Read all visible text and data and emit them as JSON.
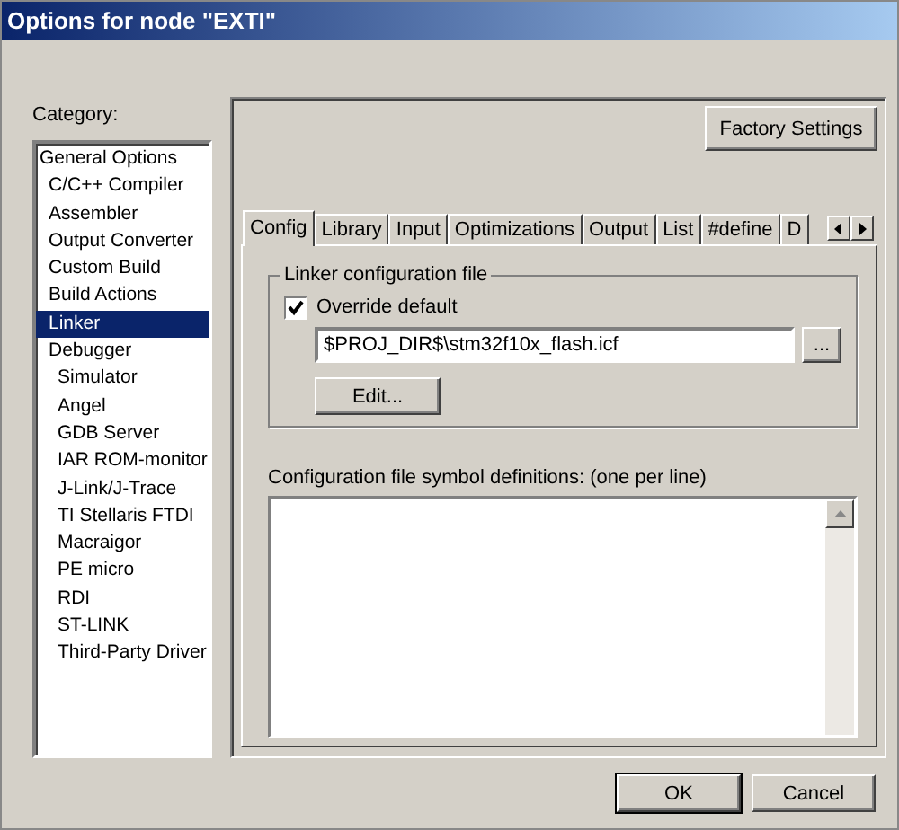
{
  "window": {
    "title": "Options for node \"EXTI\""
  },
  "category": {
    "label": "Category:",
    "items": [
      {
        "label": "General Options",
        "selected": false,
        "children": [
          {
            "label": "C/C++ Compiler",
            "selected": false
          },
          {
            "label": "Assembler",
            "selected": false
          },
          {
            "label": "Output Converter",
            "selected": false
          },
          {
            "label": "Custom Build",
            "selected": false
          },
          {
            "label": "Build Actions",
            "selected": false
          },
          {
            "label": "Linker",
            "selected": true
          },
          {
            "label": "Debugger",
            "selected": false,
            "children": [
              {
                "label": "Simulator",
                "selected": false
              },
              {
                "label": "Angel",
                "selected": false
              },
              {
                "label": "GDB Server",
                "selected": false
              },
              {
                "label": "IAR ROM-monitor",
                "selected": false
              },
              {
                "label": "J-Link/J-Trace",
                "selected": false
              },
              {
                "label": "TI Stellaris FTDI",
                "selected": false
              },
              {
                "label": "Macraigor",
                "selected": false
              },
              {
                "label": "PE micro",
                "selected": false
              },
              {
                "label": "RDI",
                "selected": false
              },
              {
                "label": "ST-LINK",
                "selected": false
              },
              {
                "label": "Third-Party Driver",
                "selected": false
              }
            ]
          }
        ]
      }
    ]
  },
  "factory_button": "Factory Settings",
  "tabs": [
    {
      "label": "Config",
      "selected": true
    },
    {
      "label": "Library",
      "selected": false
    },
    {
      "label": "Input",
      "selected": false
    },
    {
      "label": "Optimizations",
      "selected": false
    },
    {
      "label": "Output",
      "selected": false
    },
    {
      "label": "List",
      "selected": false
    },
    {
      "label": "#define",
      "selected": false
    },
    {
      "label": "D",
      "selected": false
    }
  ],
  "linker_group": {
    "title": "Linker configuration file",
    "override": {
      "label": "Override default",
      "checked": true
    },
    "path": "$PROJ_DIR$\\stm32f10x_flash.icf",
    "browse": "...",
    "edit": "Edit..."
  },
  "symbols": {
    "label": "Configuration file symbol definitions: (one per line)"
  },
  "buttons": [
    "OK",
    "Cancel"
  ]
}
